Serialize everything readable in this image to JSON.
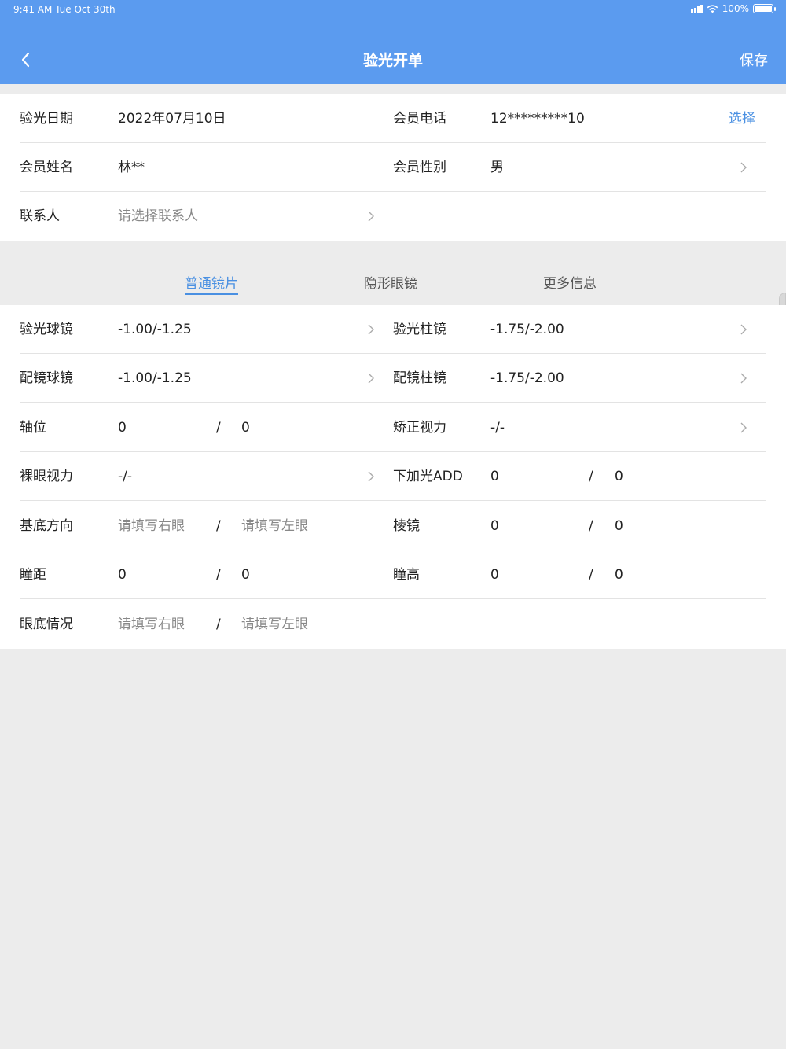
{
  "status": {
    "time": "9:41 AM  Tue Oct 30th",
    "battery": "100%"
  },
  "header": {
    "title": "验光开单",
    "save": "保存"
  },
  "info": {
    "date_label": "验光日期",
    "date_value": "2022年07月10日",
    "phone_label": "会员电话",
    "phone_value": "12*********10",
    "select": "选择",
    "name_label": "会员姓名",
    "name_value": "林**",
    "gender_label": "会员性别",
    "gender_value": "男",
    "contact_label": "联系人",
    "contact_placeholder": "请选择联系人"
  },
  "tabs": [
    "普通镜片",
    "隐形眼镜",
    "更多信息"
  ],
  "form": {
    "r1": {
      "l1": "验光球镜",
      "v1": "-1.00/-1.25",
      "l2": "验光柱镜",
      "v2": "-1.75/-2.00"
    },
    "r2": {
      "l1": "配镜球镜",
      "v1": "-1.00/-1.25",
      "l2": "配镜柱镜",
      "v2": "-1.75/-2.00"
    },
    "r3": {
      "l1": "轴位",
      "a": "0",
      "b": "0",
      "l2": "矫正视力",
      "v2": "-/-"
    },
    "r4": {
      "l1": "裸眼视力",
      "v1": "-/-",
      "l2": "下加光ADD",
      "a": "0",
      "b": "0"
    },
    "r5": {
      "l1": "基底方向",
      "ph_right": "请填写右眼",
      "ph_left": "请填写左眼",
      "l2": "棱镜",
      "a": "0",
      "b": "0"
    },
    "r6": {
      "l1": "瞳距",
      "a": "0",
      "b": "0",
      "l2": "瞳高",
      "c": "0",
      "d": "0"
    },
    "r7": {
      "l1": "眼底情况",
      "ph_right": "请填写右眼",
      "ph_left": "请填写左眼"
    },
    "slash": "/"
  },
  "colors": {
    "primary": "#5b9bef",
    "accent": "#4a90e2",
    "background": "#ececec"
  }
}
